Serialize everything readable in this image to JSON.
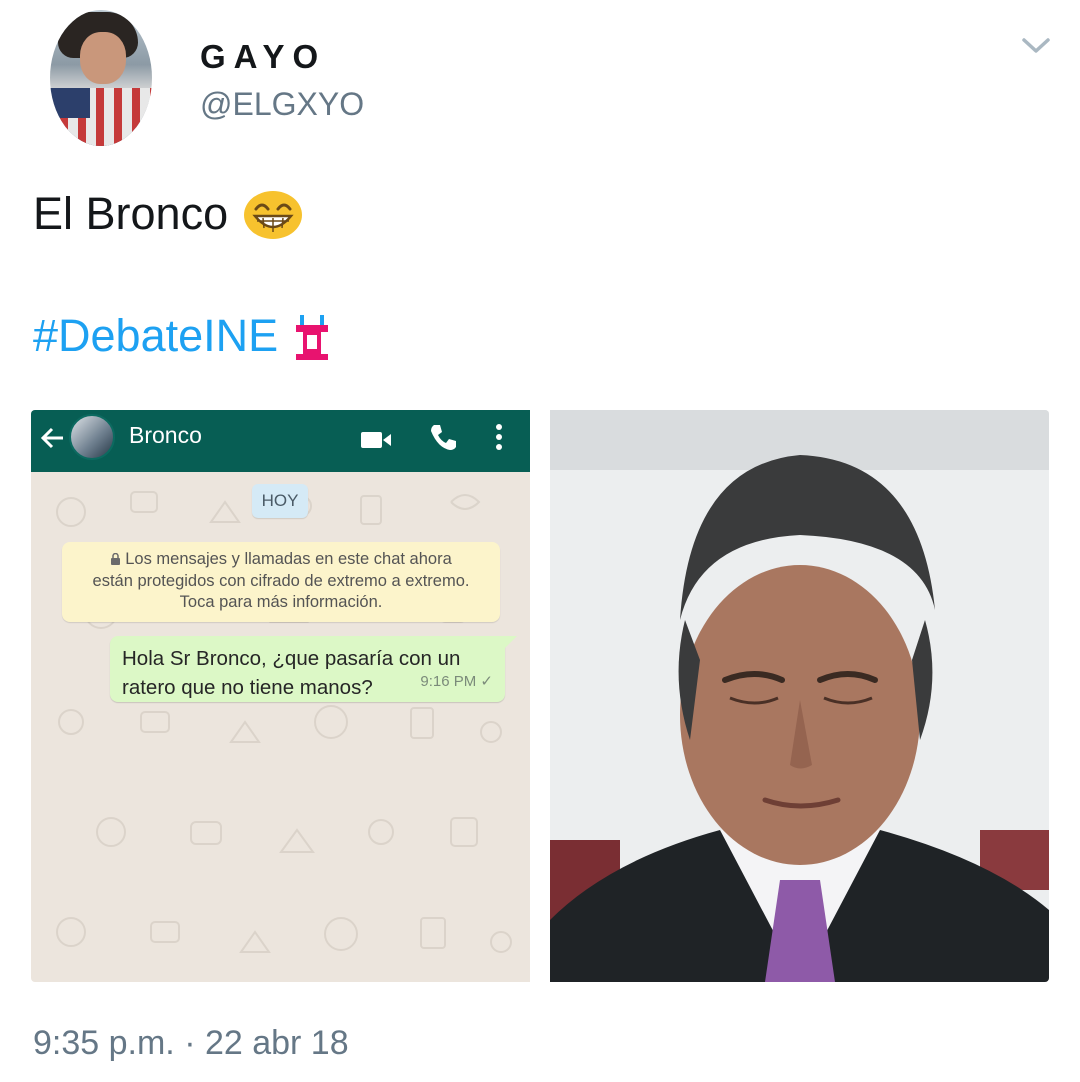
{
  "tweet": {
    "display_name": "GAYO",
    "handle": "@ELGXYO",
    "text": "El Bronco",
    "text_emoji": "laughing-face-emoji",
    "hashtag": "#DebateINE",
    "hashtag_emoji": "podium-emoji",
    "timestamp": "9:35 p.m. · 22 abr 18"
  },
  "whatsapp": {
    "contact_name": "Bronco",
    "date_chip": "HOY",
    "notice_line1": "Los mensajes y llamadas en este chat ahora",
    "notice_line2": "están protegidos con cifrado de extremo a extremo.",
    "notice_line3": "Toca para más información.",
    "message_line1": "Hola Sr Bronco, ¿que pasaría con un",
    "message_line2": "ratero que no tiene manos?",
    "message_time": "9:16 PM ✓"
  },
  "colors": {
    "link": "#1da1f2",
    "whatsapp_header": "#075e54",
    "bubble": "#dcf8c6",
    "notice": "#fcf4cb"
  }
}
